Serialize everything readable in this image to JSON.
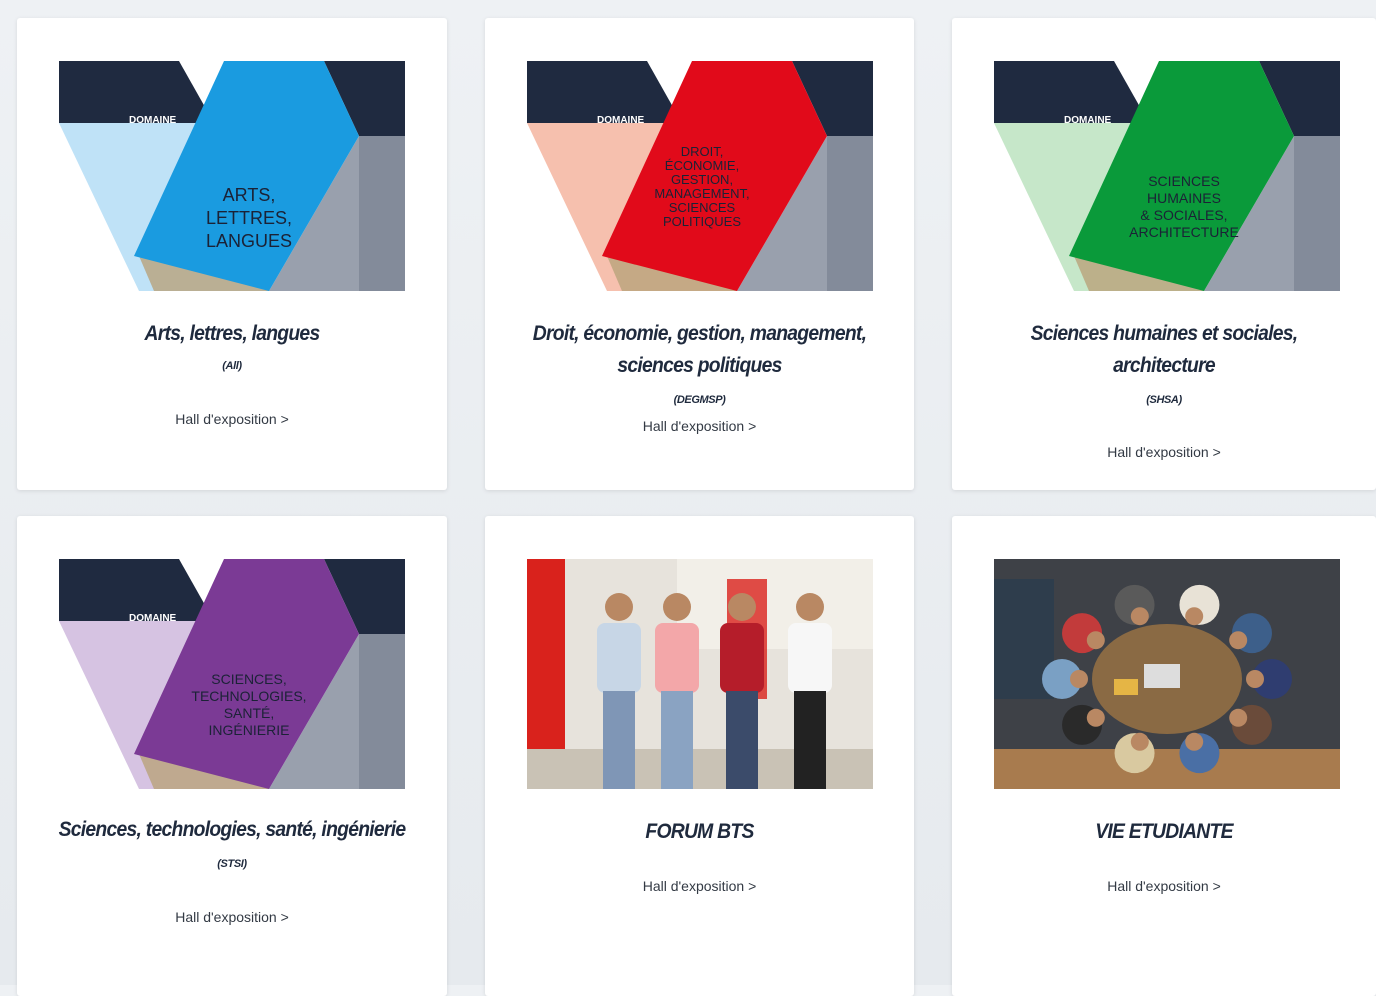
{
  "cards": [
    {
      "title_lines": [
        "Arts, lettres, langues"
      ],
      "abbr": "(All)",
      "link": "Hall d'exposition >",
      "image": {
        "kind": "domain",
        "domain_tag": "DOMAINE",
        "lines": [
          "ARTS,",
          "LETTRES,",
          "LANGUES"
        ],
        "accent": "#1a9be0",
        "light": "#bfe2f7",
        "dark": "#1f2a40"
      }
    },
    {
      "title_lines": [
        "Droit, économie, gestion, management,",
        "sciences politiques"
      ],
      "abbr": "(DEGMSP)",
      "link": "Hall d'exposition >",
      "image": {
        "kind": "domain",
        "domain_tag": "DOMAINE",
        "lines": [
          "DROIT,",
          "ÉCONOMIE,",
          "GESTION,",
          "MANAGEMENT,",
          "SCIENCES",
          "POLITIQUES"
        ],
        "accent": "#e10a1a",
        "light": "#f6c0ae",
        "dark": "#1f2a40"
      }
    },
    {
      "title_lines": [
        "Sciences humaines et sociales,",
        "architecture"
      ],
      "abbr": "(SHSA)",
      "link": "Hall d'exposition >",
      "image": {
        "kind": "domain",
        "domain_tag": "DOMAINE",
        "lines": [
          "SCIENCES",
          "HUMAINES",
          "& SOCIALES,",
          "ARCHITECTURE"
        ],
        "accent": "#0a9a3a",
        "light": "#c6e7c9",
        "dark": "#1f2a40"
      }
    },
    {
      "title_lines": [
        "Sciences, technologies, santé, ingénierie"
      ],
      "abbr": "(STSI)",
      "link": "Hall d'exposition >",
      "image": {
        "kind": "domain",
        "domain_tag": "DOMAINE",
        "lines": [
          "SCIENCES,",
          "TECHNOLOGIES,",
          "SANTÉ,",
          "INGÉNIERIE"
        ],
        "accent": "#7b3a95",
        "light": "#d6c3e2",
        "dark": "#1f2a40"
      }
    },
    {
      "title_lines": [
        "FORUM BTS"
      ],
      "abbr": "",
      "link": "Hall d'exposition >",
      "image": {
        "kind": "photo-students-walking"
      }
    },
    {
      "title_lines": [
        "VIE ETUDIANTE"
      ],
      "abbr": "",
      "link": "Hall d'exposition >",
      "image": {
        "kind": "photo-students-group"
      }
    }
  ]
}
